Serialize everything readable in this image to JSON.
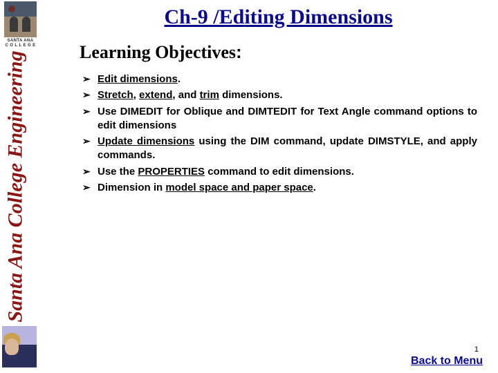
{
  "sidebar": {
    "college_line1": "SANTA ANA",
    "college_line2": "C O L L E G E",
    "vertical_text": "Santa Ana College Engineering"
  },
  "title": "Ch-9 /Editing Dimensions",
  "subhead": "Learning Objectives",
  "objectives": [
    {
      "parts": [
        {
          "t": "Edit dimensions",
          "u": true
        },
        {
          "t": "."
        }
      ]
    },
    {
      "parts": [
        {
          "t": "Stretch",
          "u": true
        },
        {
          "t": ", "
        },
        {
          "t": "extend",
          "u": true
        },
        {
          "t": ", and "
        },
        {
          "t": "trim",
          "u": true
        },
        {
          "t": " dimensions."
        }
      ]
    },
    {
      "parts": [
        {
          "t": "Use DIMEDIT for Oblique and DIMTEDIT for Text Angle command options to edit dimensions"
        }
      ]
    },
    {
      "parts": [
        {
          "t": "Update ",
          "u": true
        },
        {
          "t": "dimensions",
          "u": true
        },
        {
          "t": " using the DIM command, update DIMSTYLE, and apply commands."
        }
      ]
    },
    {
      "parts": [
        {
          "t": "Use the "
        },
        {
          "t": "PROPERTIES",
          "u": true
        },
        {
          "t": " command to edit dimensions."
        }
      ]
    },
    {
      "parts": [
        {
          "t": "Dimension in "
        },
        {
          "t": "model space and paper space",
          "u": true
        },
        {
          "t": "."
        }
      ]
    }
  ],
  "page_number": "1",
  "back_link": "Back to Menu"
}
